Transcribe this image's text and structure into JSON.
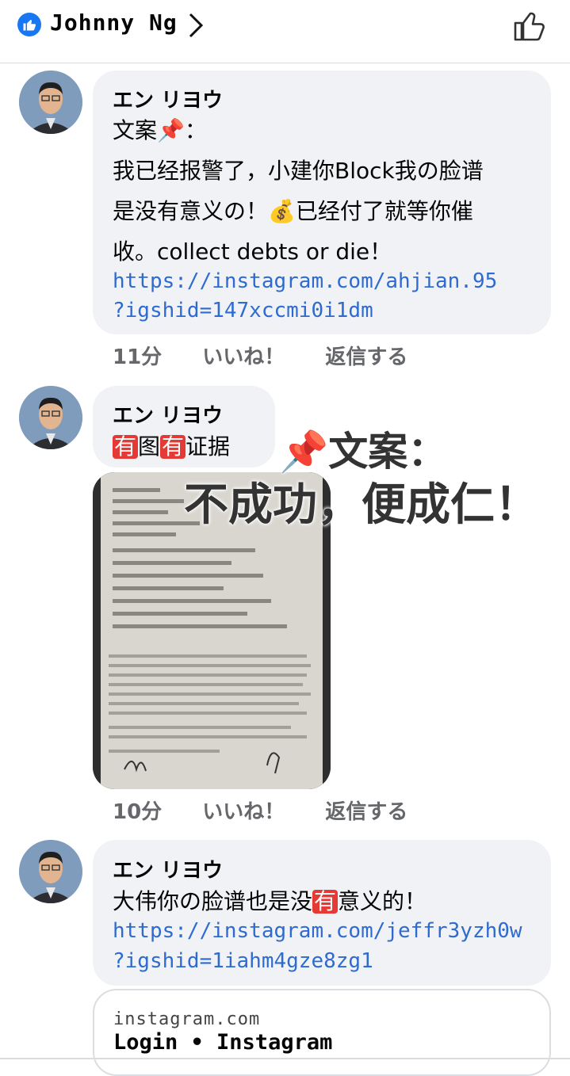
{
  "header": {
    "name": "Johnny Ng",
    "like_icon": "thumbs-up-icon",
    "accent": "#1877f2"
  },
  "comments": [
    {
      "author": "エン リヨウ",
      "lines": [
        "文案📌：",
        "我已经报警了，小建你Block我の脸谱",
        "是没有意义の！💰已经付了就等你催",
        "收。collect debts or die！"
      ],
      "link_lines": [
        "https://instagram.com/ahjian.95",
        "?igshid=147xccmi0i1dm"
      ],
      "time": "11分",
      "like": "いいね！",
      "reply": "返信する"
    },
    {
      "author": "エン リヨウ",
      "text_parts": [
        "有",
        "图",
        "有",
        "证据"
      ],
      "overlay_line1": "📌文案：",
      "overlay_line2": "不成功，便成仁！",
      "time": "10分",
      "like": "いいね！",
      "reply": "返信する"
    },
    {
      "author": "エン リヨウ",
      "text_parts": [
        "大伟你の脸谱也是没",
        "有",
        "意义的！"
      ],
      "link_lines": [
        "https://instagram.com/jeffr3yzh0w",
        "?igshid=1iahm4gze8zg1"
      ],
      "preview": {
        "domain": "instagram.com",
        "title": "Login • Instagram"
      }
    }
  ]
}
